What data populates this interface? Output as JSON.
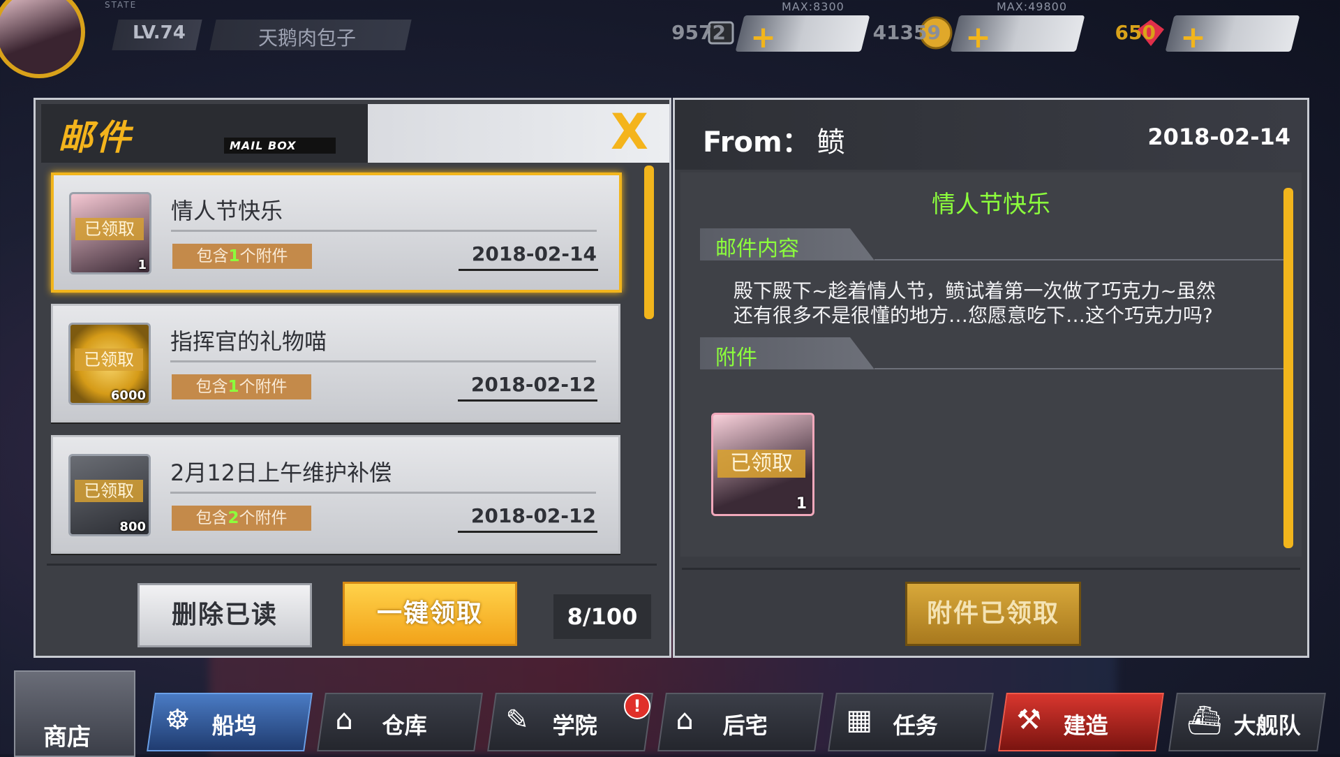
{
  "top": {
    "level": "LV.74",
    "player_name": "天鹅肉包子",
    "state_label": "STATE",
    "resources": [
      {
        "icon": "oil-icon",
        "max": "MAX:8300",
        "value": "9572"
      },
      {
        "icon": "coin-icon",
        "max": "MAX:49800",
        "value": "41359"
      },
      {
        "icon": "gem-icon",
        "max": "",
        "value": "650"
      }
    ],
    "plus": "+"
  },
  "mailbox": {
    "title": "邮件",
    "subtitle": "MAIL BOX",
    "close": "X",
    "items": [
      {
        "title": "情人节快乐",
        "stamp": "已领取",
        "qty": "1",
        "att_pre": "包含",
        "att_num": "1",
        "att_post": "个附件",
        "date": "2018-02-14"
      },
      {
        "title": "指挥官的礼物喵",
        "stamp": "已领取",
        "qty": "6000",
        "att_pre": "包含",
        "att_num": "1",
        "att_post": "个附件",
        "date": "2018-02-12"
      },
      {
        "title": "2月12日上午维护补偿",
        "stamp": "已领取",
        "qty": "800",
        "att_pre": "包含",
        "att_num": "2",
        "att_post": "个附件",
        "date": "2018-02-12"
      }
    ],
    "delete_read": "删除已读",
    "claim_all": "一键领取",
    "count": "8/100"
  },
  "detail": {
    "from_label": "From：",
    "from_name": "鲼",
    "date": "2018-02-14",
    "title": "情人节快乐",
    "content_label": "邮件内容",
    "content_line1": "殿下殿下~趁着情人节，鲼试着第一次做了巧克力~虽然",
    "content_line2": "还有很多不是很懂的地方…您愿意吃下…这个巧克力吗?",
    "attach_label": "附件",
    "attach_stamp": "已领取",
    "attach_qty": "1",
    "claimed_button": "附件已领取"
  },
  "nav": {
    "shop": "商店",
    "items": [
      "船坞",
      "仓库",
      "学院",
      "后宅",
      "任务",
      "建造",
      "大舰队"
    ],
    "badge": "!"
  },
  "colors": {
    "accent": "#f2b51c",
    "green": "#8cff3c"
  }
}
